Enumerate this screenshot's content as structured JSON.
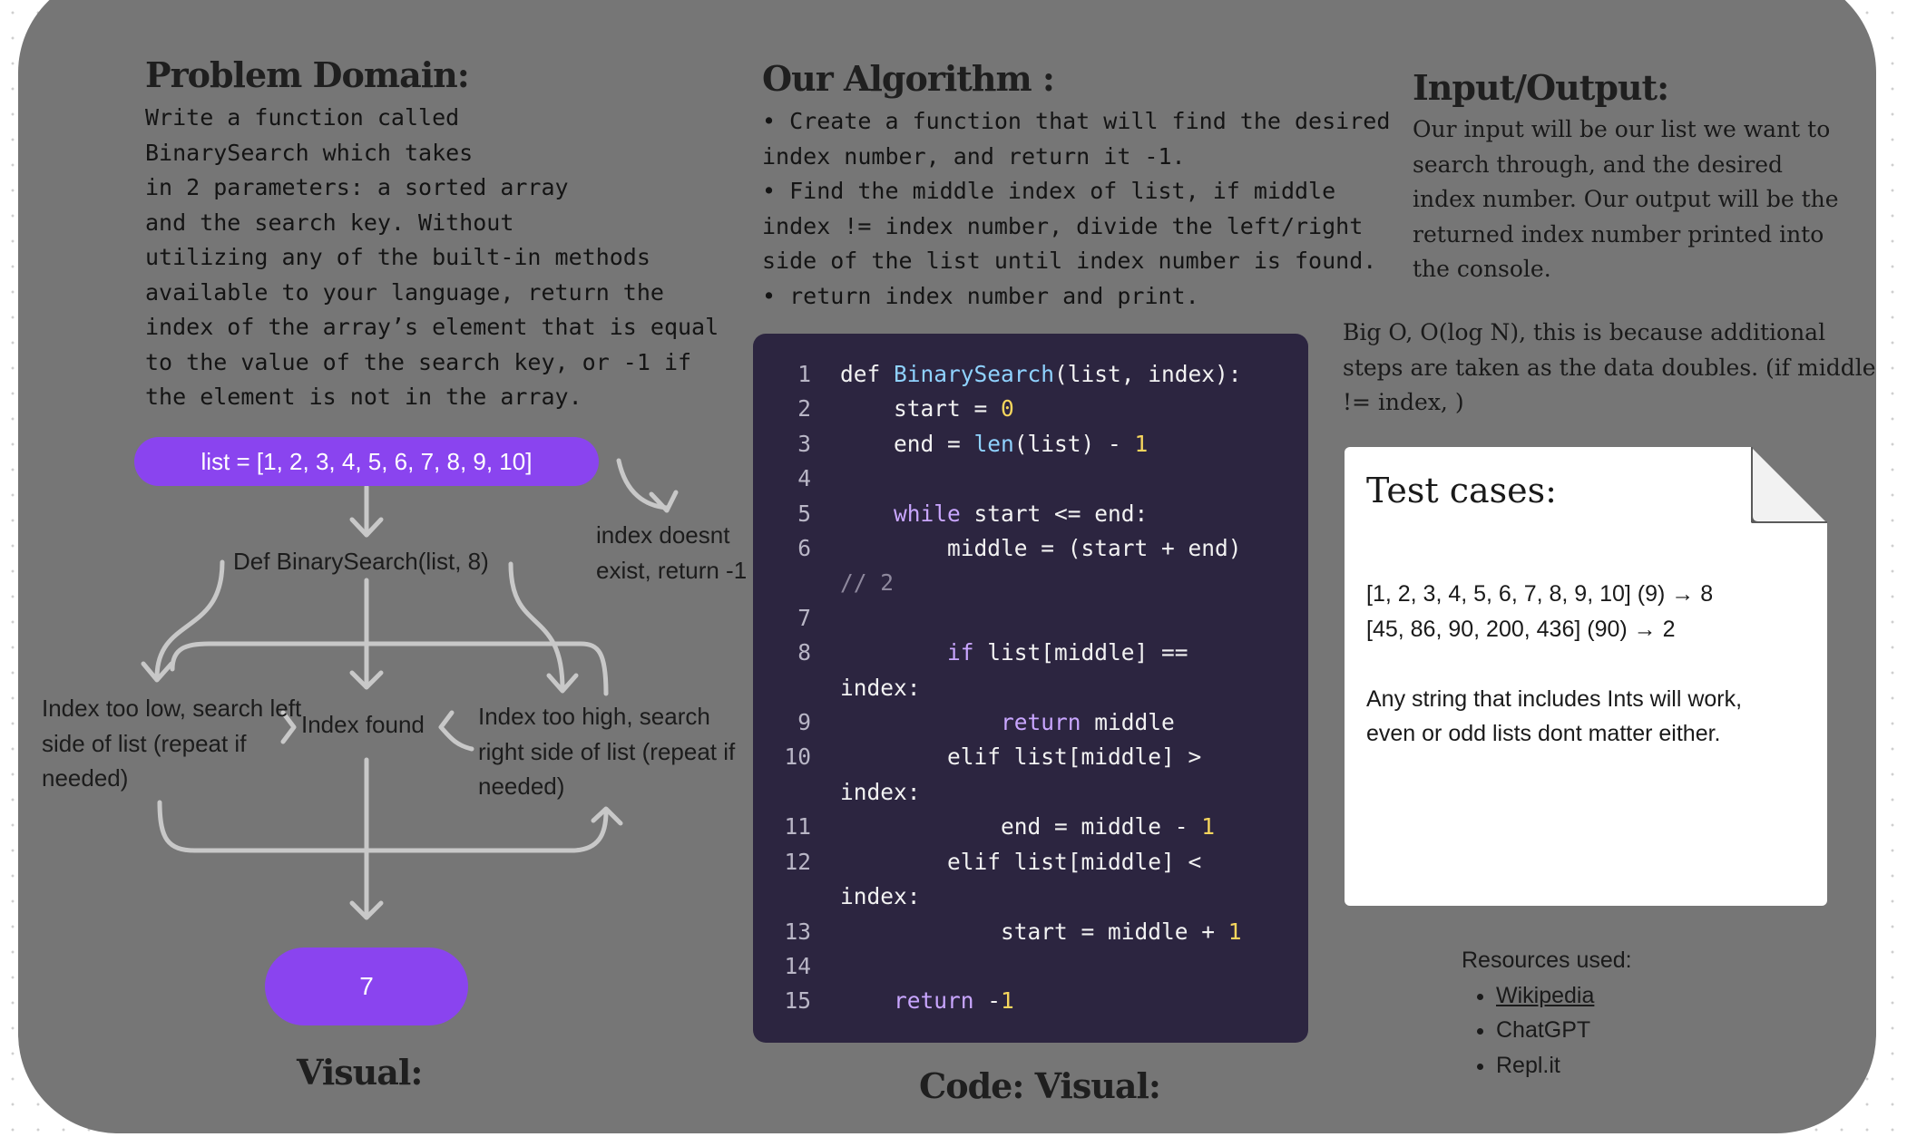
{
  "problem_domain": {
    "title": "Problem Domain:",
    "text": "Write a function called\nBinarySearch which takes\nin 2 parameters: a sorted array\nand the search key. Without\nutilizing any of the built-in methods\navailable to your language, return the\nindex of the array’s element that is equal\nto the value of the search key, or -1 if\nthe element is not in the array."
  },
  "algorithm": {
    "title": "Our Algorithm :",
    "items": [
      "Create a function that will find the desired index number, and return it -1.",
      "Find the middle index of list, if middle index != index number, divide the left/right side of the list until index number is found.",
      "return index number and print."
    ]
  },
  "input_output": {
    "title": "Input/Output:",
    "text": "Our input will be our list we want to search through, and the desired index number. Our output will be the returned index number printed into the console."
  },
  "big_o": "Big O, O(log N), this is because additional steps are taken as the data doubles. (if middle != index, )",
  "flowchart": {
    "list": "list = [1, 2, 3, 4, 5, 6, 7, 8, 9, 10]",
    "call": "Def BinarySearch(list, 8)",
    "not_exist": "index doesnt exist, return -1",
    "too_low": "Index too low, search left side of list (repeat if needed)",
    "found": "Index found",
    "too_high": "Index too high, search right side of list (repeat if needed)",
    "result": "7",
    "title": "Visual:"
  },
  "code": {
    "title": "Code: Visual:",
    "line_numbers": [
      "1",
      "2",
      "3",
      "4",
      "5",
      "6",
      "7",
      "8",
      "9",
      "10",
      "11",
      "12",
      "13",
      "14",
      "15"
    ]
  },
  "test_cases": {
    "title": "Test cases:",
    "lines": [
      "[1, 2, 3, 4, 5, 6, 7, 8, 9, 10] (9) → 8",
      "[45, 86, 90, 200, 436] (90) → 2",
      "Any string that includes Ints will work, even or odd lists dont matter either."
    ]
  },
  "resources": {
    "title": "Resources used:",
    "items": [
      "Wikipedia",
      "ChatGPT",
      "Repl.it"
    ]
  },
  "colors": {
    "board": "#767676",
    "pill": "#8a44ef",
    "code_bg": "#2c2540",
    "arrow": "#c8c8c8"
  }
}
